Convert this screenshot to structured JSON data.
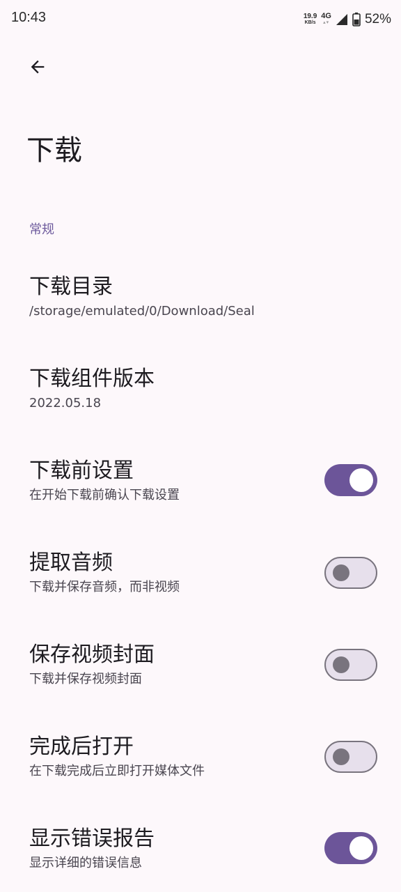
{
  "status_bar": {
    "time": "10:43",
    "net_speed": "19.9",
    "net_unit": "KB/s",
    "network_type": "4G",
    "battery": "52%"
  },
  "header": {
    "back_icon": "arrow-back-icon",
    "title": "下载"
  },
  "section": {
    "label": "常规"
  },
  "items": [
    {
      "title": "下载目录",
      "subtitle": "/storage/emulated/0/Download/Seal"
    },
    {
      "title": "下载组件版本",
      "subtitle": "2022.05.18"
    },
    {
      "title": "下载前设置",
      "subtitle": "在开始下载前确认下载设置",
      "toggle": true
    },
    {
      "title": "提取音频",
      "subtitle": "下载并保存音频，而非视频",
      "toggle": false
    },
    {
      "title": "保存视频封面",
      "subtitle": "下载并保存视频封面",
      "toggle": false
    },
    {
      "title": "完成后打开",
      "subtitle": "在下载完成后立即打开媒体文件",
      "toggle": false
    },
    {
      "title": "显示错误报告",
      "subtitle": "显示详细的错误信息",
      "toggle": true
    }
  ],
  "colors": {
    "accent": "#6c5599",
    "background": "#fdf8fb",
    "section_label": "#6d5a9c"
  }
}
